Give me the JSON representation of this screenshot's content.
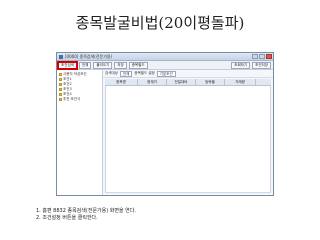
{
  "slide_title": "종목발굴비법(20이평돌파)",
  "window": {
    "title": "[0000] 종목검색(전문가용)",
    "toolbar": [
      "조건검색",
      "전체",
      "불러오기",
      "저장",
      "종목필드"
    ],
    "toolbar_right": [
      "조회하기",
      "조건저장"
    ]
  },
  "tree": {
    "items": [
      "사용자 작성조건",
      "조건1",
      "조건2",
      "조건3",
      "조건4",
      "추천 조건식"
    ]
  },
  "filter": {
    "label1": "검색대상",
    "value1": "전체",
    "label2": "종목필드 설정",
    "value2": "기본조건"
  },
  "grid": {
    "columns": [
      "종목명",
      "현재가",
      "전일대비",
      "등락율",
      "거래량"
    ]
  },
  "notes": [
    "1. 홈편 8832 종목검색(전문가용) 화면을 연다.",
    "2. 조건설정 버튼을 클릭한다."
  ]
}
